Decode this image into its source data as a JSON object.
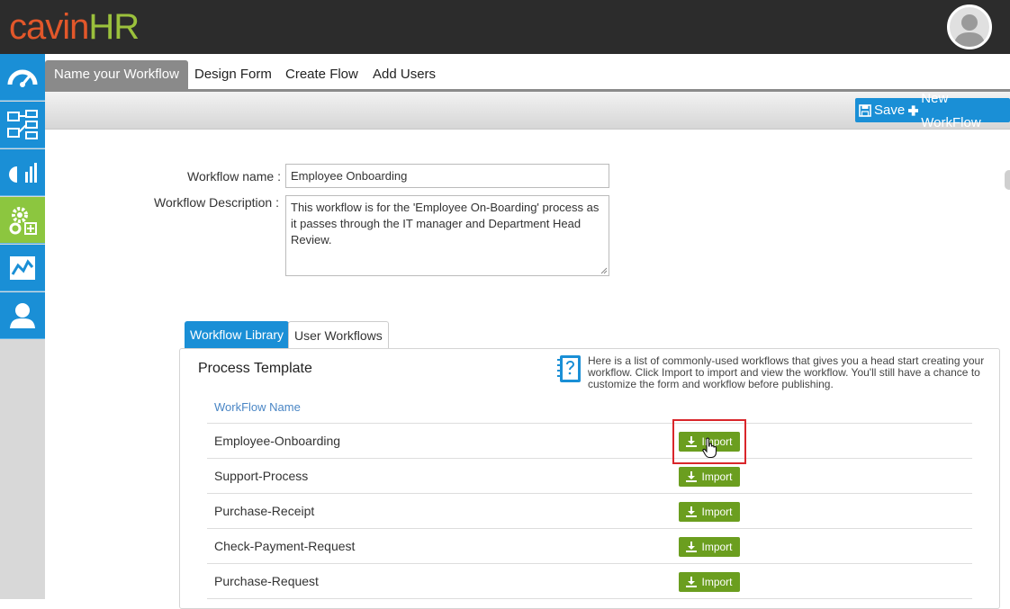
{
  "app": {
    "logo_part1": "cavin",
    "logo_part2": "HR"
  },
  "sidebar": {
    "items": [
      {
        "icon": "dashboard-icon"
      },
      {
        "icon": "workflow-icon"
      },
      {
        "icon": "reports-chart-icon"
      },
      {
        "icon": "settings-gears-icon",
        "active": true
      },
      {
        "icon": "analytics-icon"
      },
      {
        "icon": "user-profile-icon"
      }
    ]
  },
  "tabs": [
    {
      "label": "Name your Workflow",
      "active": true
    },
    {
      "label": "Design Form"
    },
    {
      "label": "Create Flow"
    },
    {
      "label": "Add Users"
    }
  ],
  "toolbar": {
    "save_label": "Save",
    "new_label": "New WorkFlow"
  },
  "form": {
    "name_label": "Workflow name :",
    "name_value": "Employee Onboarding",
    "desc_label": "Workflow Description :",
    "desc_value": "This workflow is for the 'Employee On-Boarding' process as it passes through the IT manager and Department Head Review."
  },
  "library": {
    "tab_library": "Workflow Library",
    "tab_user": "User Workflows",
    "title": "Process Template",
    "help_text": "Here is a list of commonly-used workflows that gives you a head start creating your workflow. Click Import to import and view the workflow. You'll still have a chance to customize the form and workflow before publishing.",
    "column_header": "WorkFlow Name",
    "import_label": "Import",
    "rows": [
      {
        "name": "Employee-Onboarding"
      },
      {
        "name": "Support-Process"
      },
      {
        "name": "Purchase-Receipt"
      },
      {
        "name": "Check-Payment-Request"
      },
      {
        "name": "Purchase-Request"
      }
    ]
  },
  "colors": {
    "accent_blue": "#1a8fd6",
    "accent_green": "#8cc63f",
    "import_green": "#6b9e1f",
    "highlight_red": "#d9262b"
  }
}
